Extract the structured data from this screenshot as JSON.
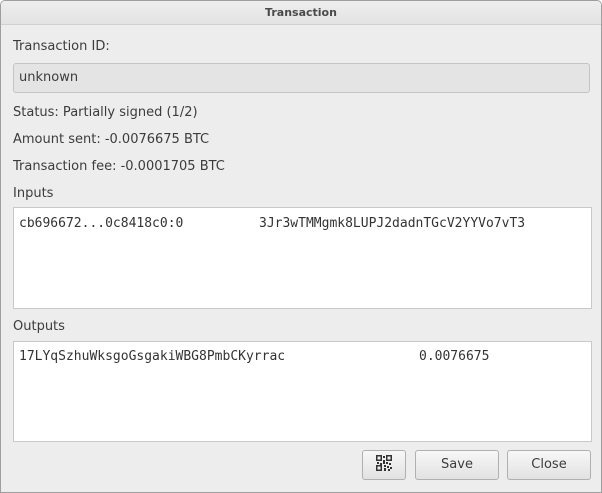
{
  "window": {
    "title": "Transaction"
  },
  "transaction": {
    "id_label": "Transaction ID:",
    "id_value": "unknown",
    "status": "Status: Partially signed (1/2)",
    "amount_sent": "Amount sent: -0.0076675 BTC",
    "fee": "Transaction fee: -0.0001705 BTC"
  },
  "inputs": {
    "label": "Inputs",
    "rows": [
      {
        "prevout": "cb696672...0c8418c0:0",
        "address": "3Jr3wTMMgmk8LUPJ2dadnTGcV2YYVo7vT3"
      }
    ]
  },
  "outputs": {
    "label": "Outputs",
    "rows": [
      {
        "address": "17LYqSzhuWksgoGsgakiWBG8PmbCKyrrac",
        "amount": "0.0076675"
      }
    ]
  },
  "buttons": {
    "qr_icon": "qr-code-icon",
    "save": "Save",
    "close": "Close"
  }
}
